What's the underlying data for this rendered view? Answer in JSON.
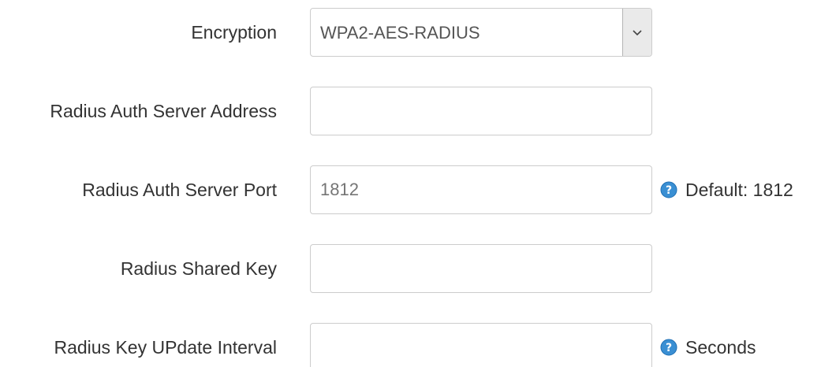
{
  "form": {
    "encryption": {
      "label": "Encryption",
      "selected": "WPA2-AES-RADIUS"
    },
    "radius_auth_server_address": {
      "label": "Radius Auth Server Address",
      "value": "",
      "placeholder": ""
    },
    "radius_auth_server_port": {
      "label": "Radius Auth Server Port",
      "value": "",
      "placeholder": "1812",
      "hint": "Default: 1812"
    },
    "radius_shared_key": {
      "label": "Radius Shared Key",
      "value": "",
      "placeholder": ""
    },
    "radius_key_update_interval": {
      "label": "Radius Key UPdate Interval",
      "value": "",
      "placeholder": "",
      "hint": "Seconds"
    }
  },
  "icons": {
    "dropdown": "chevron-down-icon",
    "help": "help-icon"
  },
  "colors": {
    "help_icon": "#3a8fd3",
    "border": "#cccccc"
  }
}
